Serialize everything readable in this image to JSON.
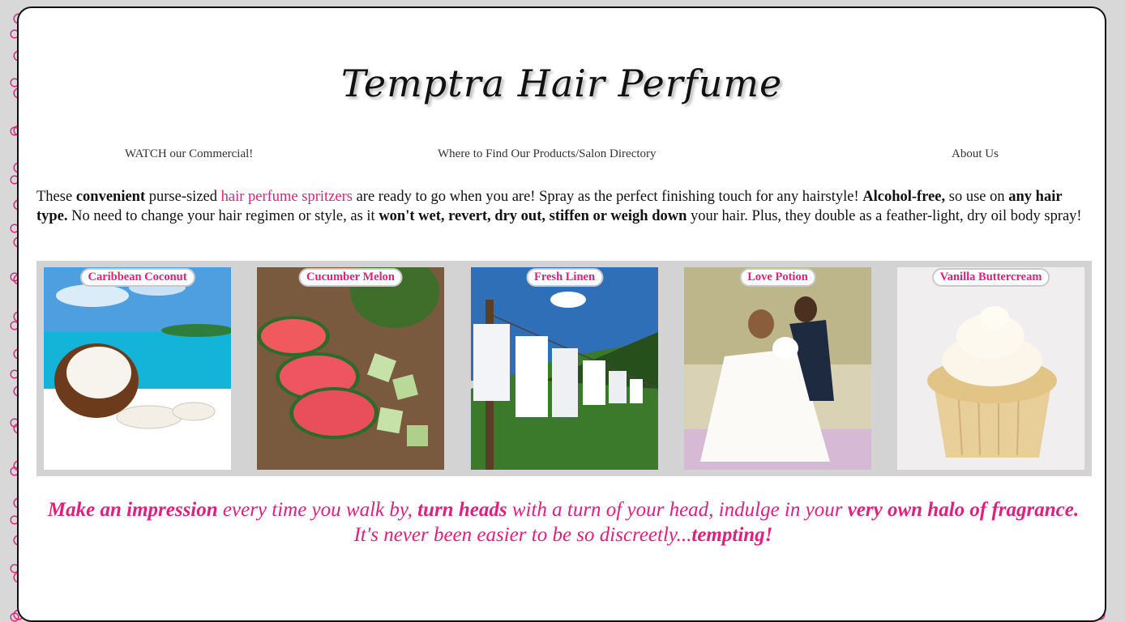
{
  "header": {
    "title": "Temptra Hair Perfume"
  },
  "nav": {
    "commercial": "WATCH our Commercial!",
    "directory": "Where to Find Our Products/Salon Directory",
    "about": "About Us"
  },
  "intro": {
    "t1": "These ",
    "b1": "convenient",
    "t2": " purse-sized ",
    "link": "hair perfume spritzers",
    "t3": " are ready to go when you are! Spray as the perfect finishing touch for any hairstyle! ",
    "b2": "Alcohol-free,",
    "t4": " so use on ",
    "b3": "any hair type.",
    "t5": " No need to change your hair regimen or style, as it ",
    "b4": "won't wet, revert, dry out, stiffen or weigh down",
    "t6": " your hair. Plus, they double as a feather-light, dry oil body spray!"
  },
  "products": [
    {
      "name": "Caribbean Coconut"
    },
    {
      "name": "Cucumber Melon"
    },
    {
      "name": "Fresh Linen"
    },
    {
      "name": "Love Potion"
    },
    {
      "name": "Vanilla Buttercream"
    }
  ],
  "tagline": {
    "p1": "Make an impression",
    "p2": " every time you walk by, ",
    "p3": "turn heads",
    "p4": " with a turn of your head, indulge in your ",
    "p5": "very own halo of fragrance.",
    "p6": "It's never been easier to be so discreetly...",
    "p7": "tempting!"
  },
  "colors": {
    "accent": "#e0207a",
    "gallery_bg": "#d3d3d3"
  }
}
